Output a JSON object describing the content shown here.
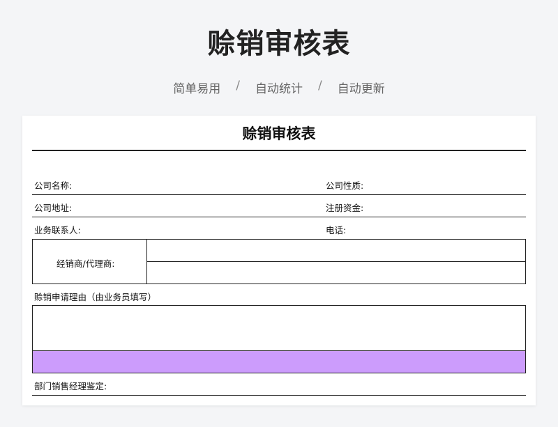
{
  "hero": {
    "title": "赊销审核表",
    "tags": [
      "简单易用",
      "自动统计",
      "自动更新"
    ],
    "separator": "/"
  },
  "form": {
    "title": "赊销审核表",
    "fields": {
      "company_name": "公司名称:",
      "company_type": "公司性质:",
      "company_address": "公司地址:",
      "registered_capital": "注册资金:",
      "sales_contact": "业务联系人:",
      "phone": "电话:",
      "dealer_agent": "经销商/代理商:",
      "reason": "赊销申请理由（由业务员填写）",
      "manager_review": "部门销售经理鉴定:"
    },
    "colors": {
      "highlight_row": "#cc9cfc"
    }
  }
}
